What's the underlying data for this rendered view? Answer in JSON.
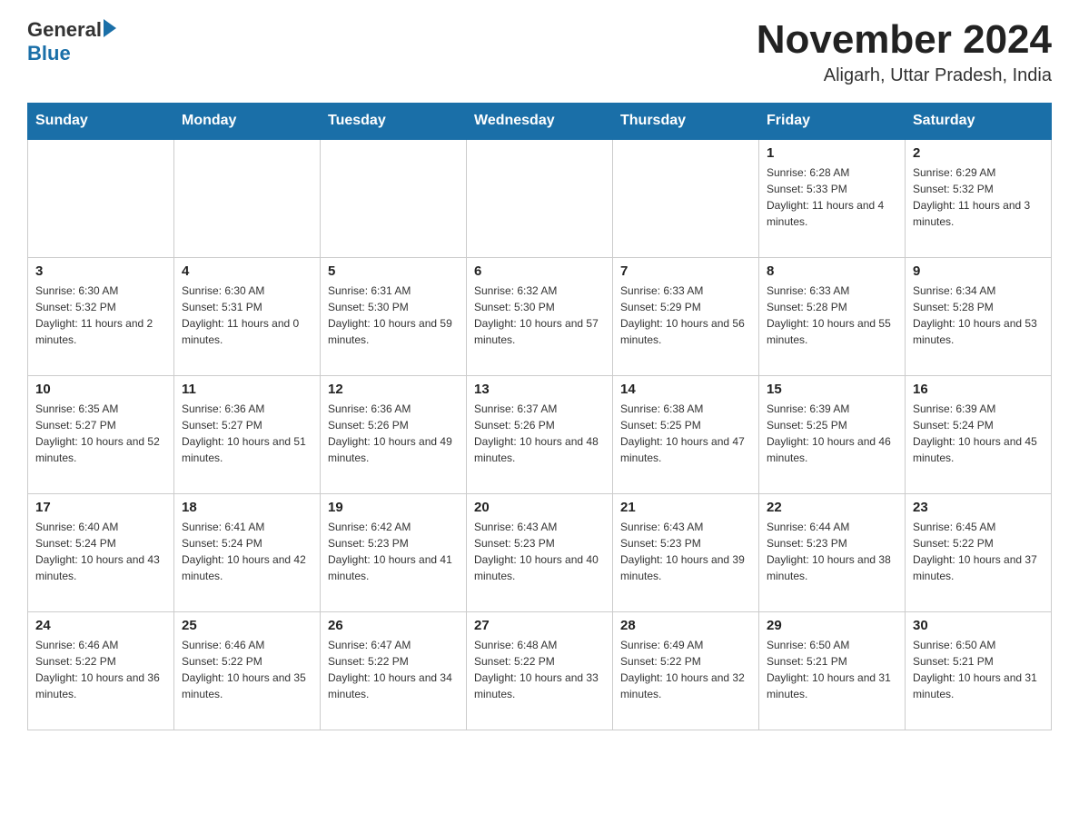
{
  "header": {
    "logo_general": "General",
    "logo_blue": "Blue",
    "month_title": "November 2024",
    "subtitle": "Aligarh, Uttar Pradesh, India"
  },
  "calendar": {
    "days_of_week": [
      "Sunday",
      "Monday",
      "Tuesday",
      "Wednesday",
      "Thursday",
      "Friday",
      "Saturday"
    ],
    "weeks": [
      [
        {
          "day": "",
          "info": ""
        },
        {
          "day": "",
          "info": ""
        },
        {
          "day": "",
          "info": ""
        },
        {
          "day": "",
          "info": ""
        },
        {
          "day": "",
          "info": ""
        },
        {
          "day": "1",
          "info": "Sunrise: 6:28 AM\nSunset: 5:33 PM\nDaylight: 11 hours and 4 minutes."
        },
        {
          "day": "2",
          "info": "Sunrise: 6:29 AM\nSunset: 5:32 PM\nDaylight: 11 hours and 3 minutes."
        }
      ],
      [
        {
          "day": "3",
          "info": "Sunrise: 6:30 AM\nSunset: 5:32 PM\nDaylight: 11 hours and 2 minutes."
        },
        {
          "day": "4",
          "info": "Sunrise: 6:30 AM\nSunset: 5:31 PM\nDaylight: 11 hours and 0 minutes."
        },
        {
          "day": "5",
          "info": "Sunrise: 6:31 AM\nSunset: 5:30 PM\nDaylight: 10 hours and 59 minutes."
        },
        {
          "day": "6",
          "info": "Sunrise: 6:32 AM\nSunset: 5:30 PM\nDaylight: 10 hours and 57 minutes."
        },
        {
          "day": "7",
          "info": "Sunrise: 6:33 AM\nSunset: 5:29 PM\nDaylight: 10 hours and 56 minutes."
        },
        {
          "day": "8",
          "info": "Sunrise: 6:33 AM\nSunset: 5:28 PM\nDaylight: 10 hours and 55 minutes."
        },
        {
          "day": "9",
          "info": "Sunrise: 6:34 AM\nSunset: 5:28 PM\nDaylight: 10 hours and 53 minutes."
        }
      ],
      [
        {
          "day": "10",
          "info": "Sunrise: 6:35 AM\nSunset: 5:27 PM\nDaylight: 10 hours and 52 minutes."
        },
        {
          "day": "11",
          "info": "Sunrise: 6:36 AM\nSunset: 5:27 PM\nDaylight: 10 hours and 51 minutes."
        },
        {
          "day": "12",
          "info": "Sunrise: 6:36 AM\nSunset: 5:26 PM\nDaylight: 10 hours and 49 minutes."
        },
        {
          "day": "13",
          "info": "Sunrise: 6:37 AM\nSunset: 5:26 PM\nDaylight: 10 hours and 48 minutes."
        },
        {
          "day": "14",
          "info": "Sunrise: 6:38 AM\nSunset: 5:25 PM\nDaylight: 10 hours and 47 minutes."
        },
        {
          "day": "15",
          "info": "Sunrise: 6:39 AM\nSunset: 5:25 PM\nDaylight: 10 hours and 46 minutes."
        },
        {
          "day": "16",
          "info": "Sunrise: 6:39 AM\nSunset: 5:24 PM\nDaylight: 10 hours and 45 minutes."
        }
      ],
      [
        {
          "day": "17",
          "info": "Sunrise: 6:40 AM\nSunset: 5:24 PM\nDaylight: 10 hours and 43 minutes."
        },
        {
          "day": "18",
          "info": "Sunrise: 6:41 AM\nSunset: 5:24 PM\nDaylight: 10 hours and 42 minutes."
        },
        {
          "day": "19",
          "info": "Sunrise: 6:42 AM\nSunset: 5:23 PM\nDaylight: 10 hours and 41 minutes."
        },
        {
          "day": "20",
          "info": "Sunrise: 6:43 AM\nSunset: 5:23 PM\nDaylight: 10 hours and 40 minutes."
        },
        {
          "day": "21",
          "info": "Sunrise: 6:43 AM\nSunset: 5:23 PM\nDaylight: 10 hours and 39 minutes."
        },
        {
          "day": "22",
          "info": "Sunrise: 6:44 AM\nSunset: 5:23 PM\nDaylight: 10 hours and 38 minutes."
        },
        {
          "day": "23",
          "info": "Sunrise: 6:45 AM\nSunset: 5:22 PM\nDaylight: 10 hours and 37 minutes."
        }
      ],
      [
        {
          "day": "24",
          "info": "Sunrise: 6:46 AM\nSunset: 5:22 PM\nDaylight: 10 hours and 36 minutes."
        },
        {
          "day": "25",
          "info": "Sunrise: 6:46 AM\nSunset: 5:22 PM\nDaylight: 10 hours and 35 minutes."
        },
        {
          "day": "26",
          "info": "Sunrise: 6:47 AM\nSunset: 5:22 PM\nDaylight: 10 hours and 34 minutes."
        },
        {
          "day": "27",
          "info": "Sunrise: 6:48 AM\nSunset: 5:22 PM\nDaylight: 10 hours and 33 minutes."
        },
        {
          "day": "28",
          "info": "Sunrise: 6:49 AM\nSunset: 5:22 PM\nDaylight: 10 hours and 32 minutes."
        },
        {
          "day": "29",
          "info": "Sunrise: 6:50 AM\nSunset: 5:21 PM\nDaylight: 10 hours and 31 minutes."
        },
        {
          "day": "30",
          "info": "Sunrise: 6:50 AM\nSunset: 5:21 PM\nDaylight: 10 hours and 31 minutes."
        }
      ]
    ]
  }
}
